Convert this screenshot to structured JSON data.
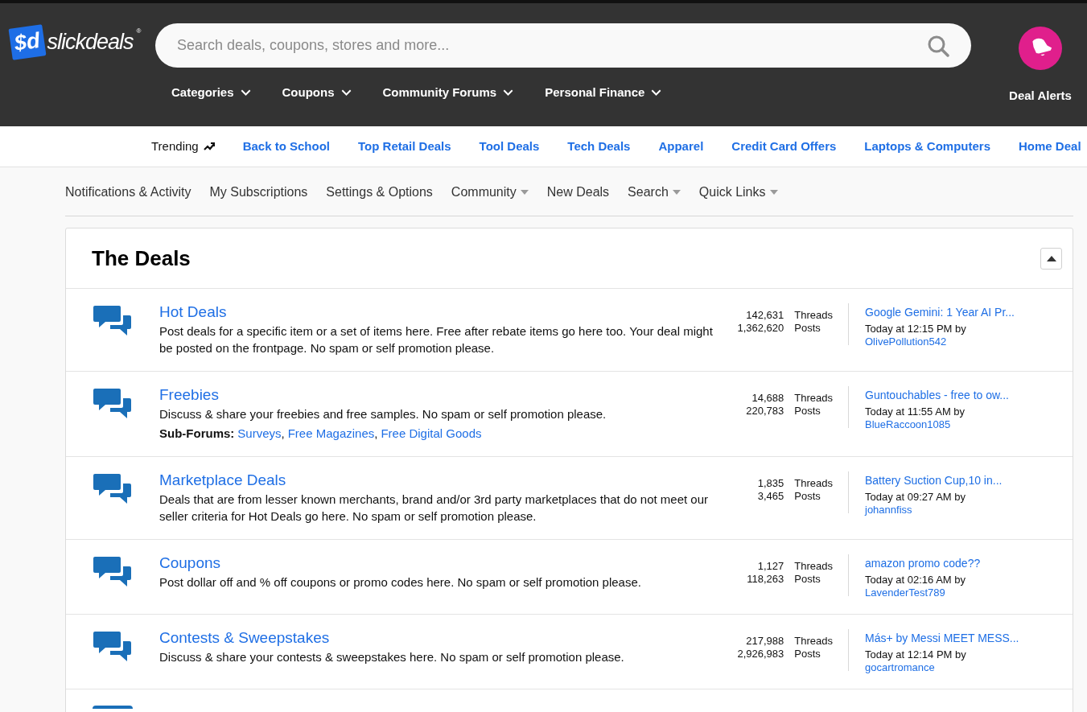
{
  "logo": {
    "mark": "$d",
    "wordmark": "slickdeals",
    "registered": "®"
  },
  "search": {
    "placeholder": "Search deals, coupons, stores and more..."
  },
  "main_nav": [
    {
      "label": "Categories"
    },
    {
      "label": "Coupons"
    },
    {
      "label": "Community Forums"
    },
    {
      "label": "Personal Finance"
    }
  ],
  "deal_alerts": {
    "label": "Deal Alerts"
  },
  "trending": {
    "label": "Trending",
    "links": [
      "Back to School",
      "Top Retail Deals",
      "Tool Deals",
      "Tech Deals",
      "Apparel",
      "Credit Card Offers",
      "Laptops & Computers",
      "Home Deal"
    ]
  },
  "sub_nav": [
    {
      "label": "Notifications & Activity",
      "dropdown": false
    },
    {
      "label": "My Subscriptions",
      "dropdown": false
    },
    {
      "label": "Settings & Options",
      "dropdown": false
    },
    {
      "label": "Community",
      "dropdown": true
    },
    {
      "label": "New Deals",
      "dropdown": false
    },
    {
      "label": "Search",
      "dropdown": true
    },
    {
      "label": "Quick Links",
      "dropdown": true
    }
  ],
  "section": {
    "title": "The Deals",
    "expanded": true,
    "forums": [
      {
        "title": "Hot Deals",
        "description": "Post deals for a specific item or a set of items here. Free after rebate items go here too. Your deal might be posted on the frontpage. No spam or self promotion please.",
        "threads": "142,631",
        "threads_label": "Threads",
        "posts": "1,362,620",
        "posts_label": "Posts",
        "last_post": {
          "title": "Google Gemini: 1 Year AI Pr...",
          "time": "Today at 12:15 PM by",
          "user": "OlivePollution542"
        }
      },
      {
        "title": "Freebies",
        "description": "Discuss & share your freebies and free samples. No spam or self promotion please.",
        "subforums_label": "Sub-Forums:",
        "subforums": [
          {
            "label": "Surveys",
            "separator": ","
          },
          {
            "label": "Free Magazines",
            "separator": ","
          },
          {
            "label": "Free Digital Goods"
          }
        ],
        "threads": "14,688",
        "threads_label": "Threads",
        "posts": "220,783",
        "posts_label": "Posts",
        "last_post": {
          "title": "Guntouchables - free to ow...",
          "time": "Today at 11:55 AM by",
          "user": "BlueRaccoon1085"
        }
      },
      {
        "title": "Marketplace Deals",
        "description": "Deals that are from lesser known merchants, brand and/or 3rd party marketplaces that do not meet our seller criteria for Hot Deals go here. No spam or self promotion please.",
        "threads": "1,835",
        "threads_label": "Threads",
        "posts": "3,465",
        "posts_label": "Posts",
        "last_post": {
          "title": "Battery Suction Cup,10 in...",
          "time": "Today at 09:27 AM by",
          "user": "johannfiss"
        }
      },
      {
        "title": "Coupons",
        "description": "Post dollar off and % off coupons or promo codes here. No spam or self promotion please.",
        "threads": "1,127",
        "threads_label": "Threads",
        "posts": "118,263",
        "posts_label": "Posts",
        "last_post": {
          "title": "amazon promo code??",
          "time": "Today at 02:16 AM by",
          "user": "LavenderTest789"
        }
      },
      {
        "title": "Contests & Sweepstakes",
        "description": "Discuss & share your contests & sweepstakes here. No spam or self promotion please.",
        "threads": "217,988",
        "threads_label": "Threads",
        "posts": "2,926,983",
        "posts_label": "Posts",
        "last_post": {
          "title": "Más+ by Messi MEET MESS...",
          "time": "Today at 12:14 PM by",
          "user": "gocartromance"
        }
      }
    ]
  }
}
